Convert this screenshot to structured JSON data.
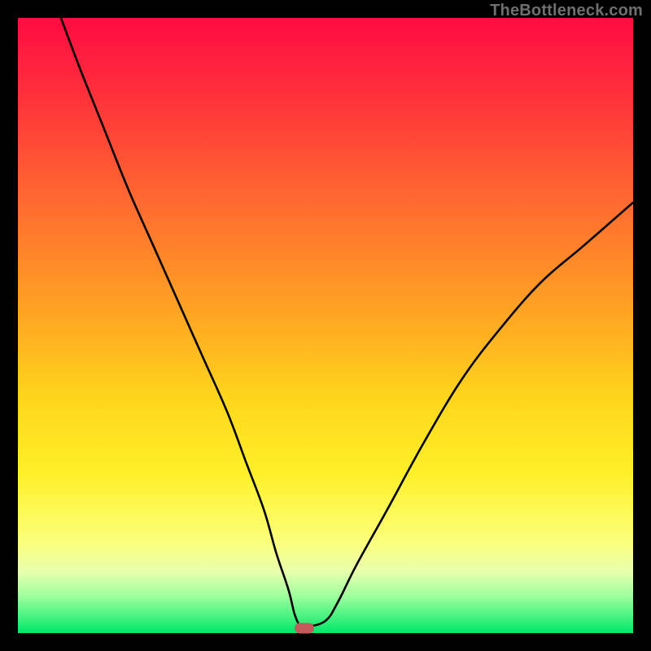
{
  "watermark": "TheBottleneck.com",
  "chart_data": {
    "type": "line",
    "title": "",
    "xlabel": "",
    "ylabel": "",
    "xlim": [
      0,
      100
    ],
    "ylim": [
      0,
      100
    ],
    "grid": false,
    "series": [
      {
        "name": "bottleneck-curve",
        "x": [
          7,
          10,
          14,
          18,
          22,
          26,
          30,
          34,
          37,
          40,
          42,
          44,
          45,
          46,
          47,
          50,
          52,
          55,
          60,
          66,
          72,
          78,
          85,
          92,
          100
        ],
        "y": [
          100,
          92,
          82,
          72,
          63,
          54,
          45,
          36,
          28,
          20,
          13,
          7,
          3,
          1,
          1,
          2,
          5,
          11,
          20,
          31,
          41,
          49,
          57,
          63,
          70
        ]
      }
    ],
    "marker": {
      "x": 46.5,
      "y": 0.8,
      "color": "#c45a5a"
    },
    "background_gradient": [
      "#ff0b42",
      "#ff6a30",
      "#ffd61c",
      "#fbff7a",
      "#00e86a"
    ]
  }
}
